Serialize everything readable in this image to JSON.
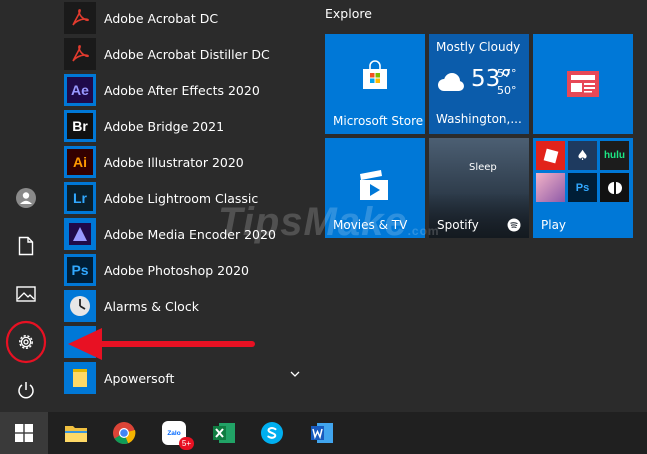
{
  "apps": [
    {
      "label": "Adobe Acrobat DC",
      "tag": "",
      "bg": "#1a1a1a",
      "fg": "#e23b2e"
    },
    {
      "label": "Adobe Acrobat Distiller DC",
      "tag": "",
      "bg": "#1a1a1a",
      "fg": "#e23b2e"
    },
    {
      "label": "Adobe After Effects 2020",
      "tag": "Ae",
      "bg": "#1f0a4a",
      "fg": "#9999ff"
    },
    {
      "label": "Adobe Bridge 2021",
      "tag": "Br",
      "bg": "#111111",
      "fg": "#ffffff"
    },
    {
      "label": "Adobe Illustrator 2020",
      "tag": "Ai",
      "bg": "#330000",
      "fg": "#ff9a00"
    },
    {
      "label": "Adobe Lightroom Classic",
      "tag": "Lr",
      "bg": "#0a1f2b",
      "fg": "#31a8ff"
    },
    {
      "label": "Adobe Media Encoder 2020",
      "tag": "",
      "bg": "#1f0a4a",
      "fg": "#9999ff"
    },
    {
      "label": "Adobe Photoshop 2020",
      "tag": "Ps",
      "bg": "#001e36",
      "fg": "#31a8ff"
    },
    {
      "label": "Alarms & Clock",
      "tag": "",
      "bg": "#0078d7",
      "fg": "#ffffff"
    },
    {
      "label": "",
      "tag": "",
      "bg": "#0078d7",
      "fg": "#ffffff"
    },
    {
      "label": "Apowersoft",
      "tag": "",
      "bg": "#0078d7",
      "fg": "#ffd966"
    }
  ],
  "explore": {
    "title": "Explore"
  },
  "tiles": {
    "store": {
      "label": "Microsoft Store"
    },
    "weather": {
      "condition": "Mostly Cloudy",
      "temp": "53°",
      "high": "57°",
      "low": "50°",
      "city": "Washington,..."
    },
    "movies": {
      "label": "Movies & TV"
    },
    "spotify": {
      "label": "Spotify",
      "sleep": "Sleep"
    },
    "play": {
      "label": "Play",
      "hulu": "hulu",
      "ps": "Ps"
    }
  },
  "watermark": {
    "text": "TipsMake",
    "domain": ".com"
  },
  "taskbar": {
    "badge": "5+",
    "zalo": "Zalo"
  },
  "colors": {
    "accent": "#0078d7",
    "highlight": "#e81123",
    "tile": "#0078d7"
  }
}
